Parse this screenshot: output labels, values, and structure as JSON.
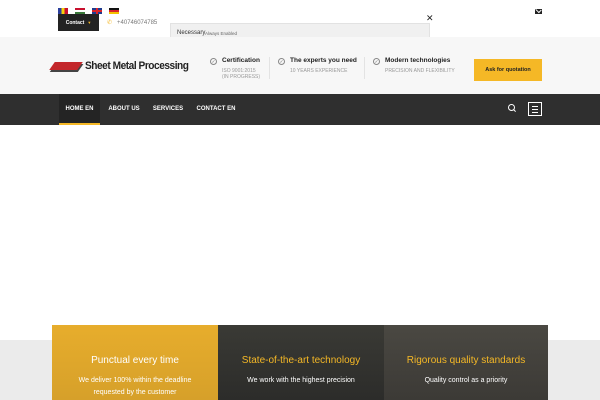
{
  "topbar": {
    "languages": [
      "ro",
      "hu",
      "en",
      "de"
    ],
    "contact_label": "Contact",
    "phone": "+40746074785"
  },
  "cookie": {
    "label": "Necessary",
    "status": "Always Enabled"
  },
  "header": {
    "logo_text": "Sheet Metal Processing",
    "features": [
      {
        "title": "Certification",
        "desc_line1": "ISO 9001:2015",
        "desc_line2": "(IN PROGRESS)"
      },
      {
        "title": "The experts you need",
        "desc_line1": "10 YEARS EXPERIENCE",
        "desc_line2": ""
      },
      {
        "title": "Modern technologies",
        "desc_line1": "PRECISION AND FLEXIBILITY",
        "desc_line2": ""
      }
    ],
    "quote_button": "Ask for quotation"
  },
  "nav": {
    "items": [
      "HOME EN",
      "ABOUT US",
      "SERVICES",
      "CONTACT EN"
    ],
    "active_index": 0
  },
  "panels": [
    {
      "title": "Punctual every time",
      "desc": "We deliver 100% within the deadline requested by the customer"
    },
    {
      "title": "State-of-the-art technology",
      "desc": "We work with the highest precision"
    },
    {
      "title": "Rigorous quality standards",
      "desc": "Quality control as a priority"
    }
  ],
  "colors": {
    "accent": "#f5b826",
    "nav_bg": "#2f2f2f",
    "brand_red": "#c3272b"
  }
}
